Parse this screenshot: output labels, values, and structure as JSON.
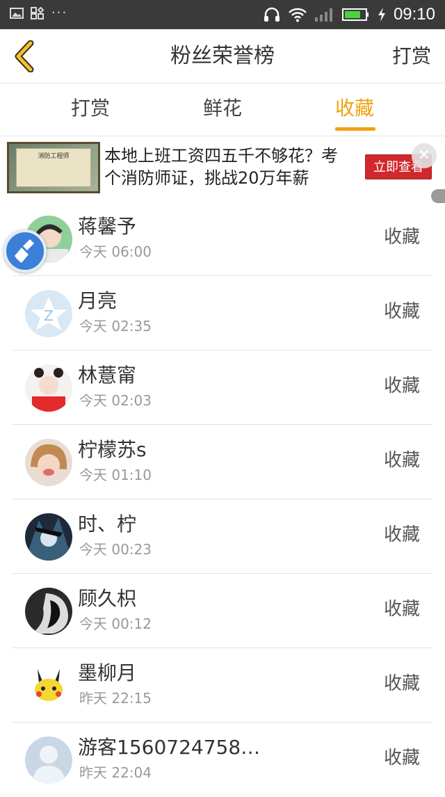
{
  "status_bar": {
    "time": "09:10",
    "left_icons": [
      "image-icon",
      "apps-icon",
      "more-dots-icon"
    ],
    "more_dots": "···",
    "right_icons": [
      "headphones-icon",
      "wifi-icon",
      "signal-icon",
      "battery-icon",
      "charging-icon"
    ]
  },
  "nav": {
    "back_icon": "back-chevron-icon",
    "title": "粉丝荣誉榜",
    "action": "打赏"
  },
  "tabs": {
    "items": [
      {
        "label": "打赏",
        "active": false
      },
      {
        "label": "鲜花",
        "active": false
      },
      {
        "label": "收藏",
        "active": true
      }
    ],
    "active_color": "#f0a20c"
  },
  "ad": {
    "image_text": "消防工程师",
    "text": "本地上班工资四五千不够花？考个消防师证，挑战20万年薪",
    "button": "立即查看",
    "close_icon": "close-icon"
  },
  "list": {
    "rows": [
      {
        "name": "蒋馨予",
        "time": "今天  06:00",
        "action": "收藏"
      },
      {
        "name": "月亮",
        "time": "今天  02:35",
        "action": "收藏"
      },
      {
        "name": "林薏甯",
        "time": "今天  02:03",
        "action": "收藏"
      },
      {
        "name": "柠檬苏s",
        "time": "今天  01:10",
        "action": "收藏"
      },
      {
        "name": "时、柠",
        "time": "今天  00:23",
        "action": "收藏"
      },
      {
        "name": "顾久枳",
        "time": "今天  00:12",
        "action": "收藏"
      },
      {
        "name": "墨柳月",
        "time": "昨天  22:15",
        "action": "收藏"
      },
      {
        "name": "游客1560724758…",
        "time": "昨天  22:04",
        "action": "收藏"
      }
    ]
  },
  "floating_button_icon": "broom-icon"
}
